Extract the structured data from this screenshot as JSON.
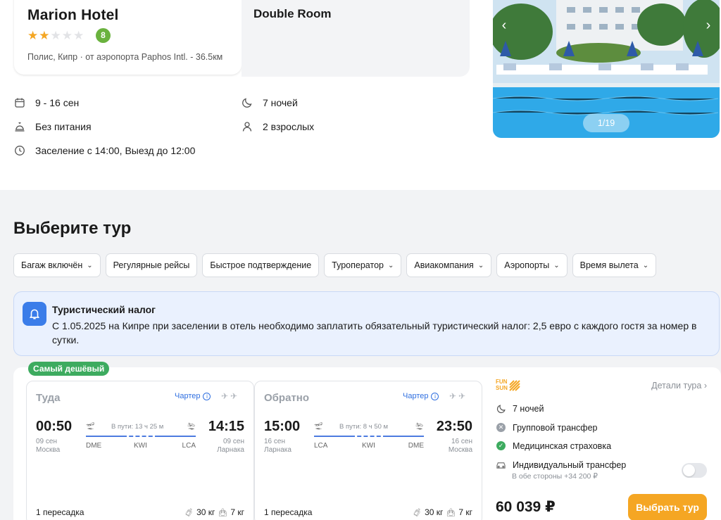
{
  "hotel": {
    "name": "Marion Hotel",
    "stars": 2,
    "stars_max": 5,
    "rating": "8",
    "location": "Полис, Кипр · от аэропорта Paphos Intl. - 36.5км"
  },
  "room": {
    "title": "Double Room"
  },
  "stay": {
    "dates": "9 - 16 сен",
    "nights": "7 ночей",
    "meals": "Без питания",
    "guests": "2 взрослых",
    "checkin": "Заселение с 14:00, Выезд до 12:00"
  },
  "gallery": {
    "counter": "1/19"
  },
  "section_title": "Выберите тур",
  "filters": [
    {
      "label": "Багаж включён",
      "dropdown": true
    },
    {
      "label": "Регулярные рейсы",
      "dropdown": false
    },
    {
      "label": "Быстрое подтверждение",
      "dropdown": false
    },
    {
      "label": "Туроператор",
      "dropdown": true
    },
    {
      "label": "Авиакомпания",
      "dropdown": true
    },
    {
      "label": "Аэропорты",
      "dropdown": true
    },
    {
      "label": "Время вылета",
      "dropdown": true
    }
  ],
  "notice": {
    "title": "Туристический налог",
    "text": "С 1.05.2025 на Кипре при заселении в отель необходимо заплатить обязательный туристический налог: 2,5 евро с каждого гостя за номер в сутки."
  },
  "offer": {
    "badge": "Самый дешёвый",
    "outbound": {
      "title": "Туда",
      "charter": "Чартер",
      "dep_time": "00:50",
      "dep_date": "09 сен",
      "dep_city": "Москва",
      "duration": "В пути: 13 ч 25 м",
      "arr_time": "14:15",
      "arr_date": "09 сен",
      "arr_city": "Ларнака",
      "codes": [
        "DME",
        "KWI",
        "LCA"
      ],
      "stops": "1 пересадка",
      "baggage": "30 кг",
      "hand": "7 кг"
    },
    "inbound": {
      "title": "Обратно",
      "charter": "Чартер",
      "dep_time": "15:00",
      "dep_date": "16 сен",
      "dep_city": "Ларнака",
      "duration": "В пути: 8 ч 50 м",
      "arr_time": "23:50",
      "arr_date": "16 сен",
      "arr_city": "Москва",
      "codes": [
        "LCA",
        "KWI",
        "DME"
      ],
      "stops": "1 пересадка",
      "baggage": "30 кг",
      "hand": "7 кг"
    },
    "operator": {
      "brand_line1": "FUN",
      "brand_line2": "SUN"
    },
    "details_link": "Детали тура",
    "nights": "7 ночей",
    "group_transfer": "Групповой трансфер",
    "insurance": "Медицинская страховка",
    "individual_transfer": "Индивидуальный трансфер",
    "individual_transfer_price": "В обе стороны +34 200 ₽",
    "price": "60 039 ₽",
    "select_label": "Выбрать тур"
  },
  "colors": {
    "accent": "#f5a623",
    "blue": "#3b7de9",
    "green": "#3dab5f"
  }
}
